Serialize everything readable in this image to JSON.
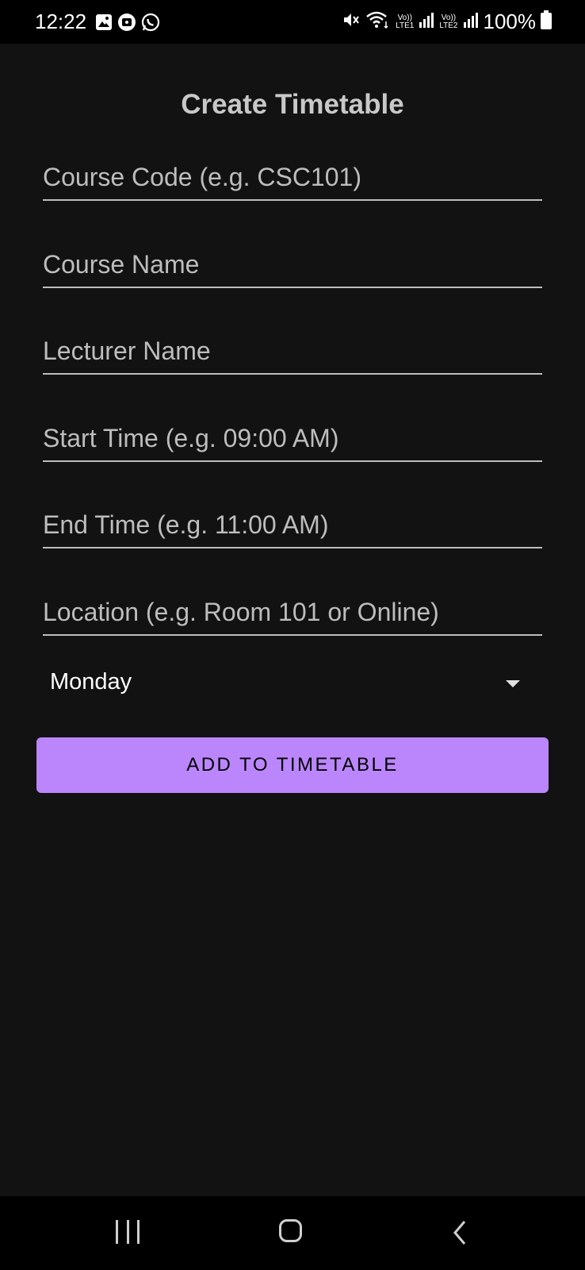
{
  "status_bar": {
    "time": "12:22",
    "left_icons": [
      "gallery-icon",
      "notification-icon",
      "whatsapp-icon"
    ],
    "right_icons": [
      "mute-icon",
      "wifi-icon",
      "signal-lte1-icon",
      "signal-lte2-icon",
      "battery-icon"
    ],
    "lte1_label_top": "Vo))",
    "lte1_label_bottom": "LTE1",
    "lte2_label_top": "Vo))",
    "lte2_label_bottom": "LTE2",
    "battery_percent": "100%"
  },
  "page": {
    "title": "Create Timetable"
  },
  "form": {
    "course_code": {
      "value": "",
      "placeholder": "Course Code (e.g. CSC101)"
    },
    "course_name": {
      "value": "",
      "placeholder": "Course Name"
    },
    "lecturer_name": {
      "value": "",
      "placeholder": "Lecturer Name"
    },
    "start_time": {
      "value": "",
      "placeholder": "Start Time (e.g. 09:00 AM)"
    },
    "end_time": {
      "value": "",
      "placeholder": "End Time (e.g. 11:00 AM)"
    },
    "location": {
      "value": "",
      "placeholder": "Location (e.g. Room 101 or Online)"
    },
    "day": {
      "selected": "Monday"
    },
    "submit_label": "ADD TO TIMETABLE"
  },
  "nav_bar": {
    "buttons": [
      "recents-icon",
      "home-icon",
      "back-icon"
    ]
  },
  "colors": {
    "background": "#121212",
    "accent": "#bb86fc",
    "status_bar": "#000000"
  }
}
